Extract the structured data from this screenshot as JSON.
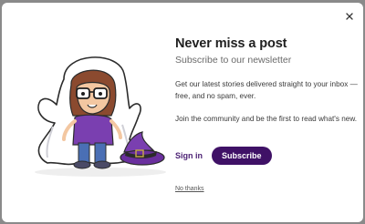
{
  "modal": {
    "title": "Never miss a post",
    "subtitle": "Subscribe to our newsletter",
    "paragraph1": "Get our latest stories delivered straight to your inbox — free, and no spam, ever.",
    "paragraph2": "Join the community and be the first to read what's new.",
    "signin_label": "Sign in",
    "subscribe_label": "Subscribe",
    "no_thanks_label": "No thanks",
    "close_icon": "close-icon",
    "illustration": "ghost-costume-character-with-witch-hat"
  },
  "colors": {
    "accent": "#3f1166",
    "link": "#4a1f73",
    "backdrop": "#8a8a8a"
  }
}
